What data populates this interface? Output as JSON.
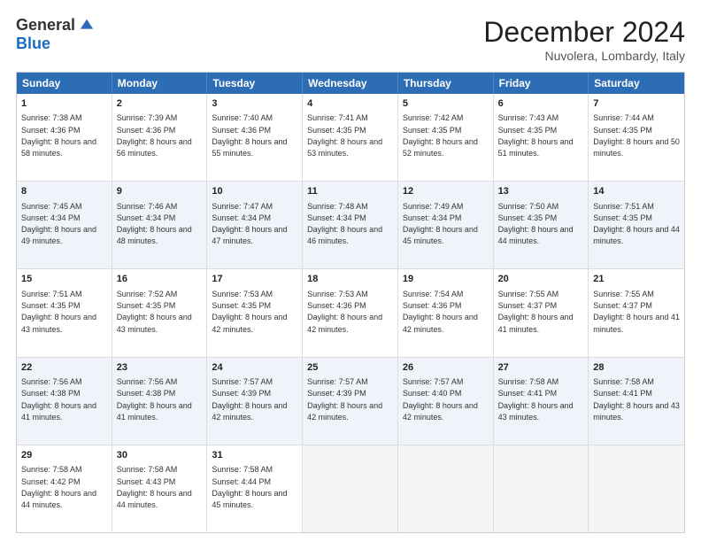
{
  "logo": {
    "general": "General",
    "blue": "Blue"
  },
  "title": "December 2024",
  "subtitle": "Nuvolera, Lombardy, Italy",
  "header_days": [
    "Sunday",
    "Monday",
    "Tuesday",
    "Wednesday",
    "Thursday",
    "Friday",
    "Saturday"
  ],
  "weeks": [
    [
      {
        "day": "1",
        "sunrise": "7:38 AM",
        "sunset": "4:36 PM",
        "daylight": "8 hours and 58 minutes."
      },
      {
        "day": "2",
        "sunrise": "7:39 AM",
        "sunset": "4:36 PM",
        "daylight": "8 hours and 56 minutes."
      },
      {
        "day": "3",
        "sunrise": "7:40 AM",
        "sunset": "4:36 PM",
        "daylight": "8 hours and 55 minutes."
      },
      {
        "day": "4",
        "sunrise": "7:41 AM",
        "sunset": "4:35 PM",
        "daylight": "8 hours and 53 minutes."
      },
      {
        "day": "5",
        "sunrise": "7:42 AM",
        "sunset": "4:35 PM",
        "daylight": "8 hours and 52 minutes."
      },
      {
        "day": "6",
        "sunrise": "7:43 AM",
        "sunset": "4:35 PM",
        "daylight": "8 hours and 51 minutes."
      },
      {
        "day": "7",
        "sunrise": "7:44 AM",
        "sunset": "4:35 PM",
        "daylight": "8 hours and 50 minutes."
      }
    ],
    [
      {
        "day": "8",
        "sunrise": "7:45 AM",
        "sunset": "4:34 PM",
        "daylight": "8 hours and 49 minutes."
      },
      {
        "day": "9",
        "sunrise": "7:46 AM",
        "sunset": "4:34 PM",
        "daylight": "8 hours and 48 minutes."
      },
      {
        "day": "10",
        "sunrise": "7:47 AM",
        "sunset": "4:34 PM",
        "daylight": "8 hours and 47 minutes."
      },
      {
        "day": "11",
        "sunrise": "7:48 AM",
        "sunset": "4:34 PM",
        "daylight": "8 hours and 46 minutes."
      },
      {
        "day": "12",
        "sunrise": "7:49 AM",
        "sunset": "4:34 PM",
        "daylight": "8 hours and 45 minutes."
      },
      {
        "day": "13",
        "sunrise": "7:50 AM",
        "sunset": "4:35 PM",
        "daylight": "8 hours and 44 minutes."
      },
      {
        "day": "14",
        "sunrise": "7:51 AM",
        "sunset": "4:35 PM",
        "daylight": "8 hours and 44 minutes."
      }
    ],
    [
      {
        "day": "15",
        "sunrise": "7:51 AM",
        "sunset": "4:35 PM",
        "daylight": "8 hours and 43 minutes."
      },
      {
        "day": "16",
        "sunrise": "7:52 AM",
        "sunset": "4:35 PM",
        "daylight": "8 hours and 43 minutes."
      },
      {
        "day": "17",
        "sunrise": "7:53 AM",
        "sunset": "4:35 PM",
        "daylight": "8 hours and 42 minutes."
      },
      {
        "day": "18",
        "sunrise": "7:53 AM",
        "sunset": "4:36 PM",
        "daylight": "8 hours and 42 minutes."
      },
      {
        "day": "19",
        "sunrise": "7:54 AM",
        "sunset": "4:36 PM",
        "daylight": "8 hours and 42 minutes."
      },
      {
        "day": "20",
        "sunrise": "7:55 AM",
        "sunset": "4:37 PM",
        "daylight": "8 hours and 41 minutes."
      },
      {
        "day": "21",
        "sunrise": "7:55 AM",
        "sunset": "4:37 PM",
        "daylight": "8 hours and 41 minutes."
      }
    ],
    [
      {
        "day": "22",
        "sunrise": "7:56 AM",
        "sunset": "4:38 PM",
        "daylight": "8 hours and 41 minutes."
      },
      {
        "day": "23",
        "sunrise": "7:56 AM",
        "sunset": "4:38 PM",
        "daylight": "8 hours and 41 minutes."
      },
      {
        "day": "24",
        "sunrise": "7:57 AM",
        "sunset": "4:39 PM",
        "daylight": "8 hours and 42 minutes."
      },
      {
        "day": "25",
        "sunrise": "7:57 AM",
        "sunset": "4:39 PM",
        "daylight": "8 hours and 42 minutes."
      },
      {
        "day": "26",
        "sunrise": "7:57 AM",
        "sunset": "4:40 PM",
        "daylight": "8 hours and 42 minutes."
      },
      {
        "day": "27",
        "sunrise": "7:58 AM",
        "sunset": "4:41 PM",
        "daylight": "8 hours and 43 minutes."
      },
      {
        "day": "28",
        "sunrise": "7:58 AM",
        "sunset": "4:41 PM",
        "daylight": "8 hours and 43 minutes."
      }
    ],
    [
      {
        "day": "29",
        "sunrise": "7:58 AM",
        "sunset": "4:42 PM",
        "daylight": "8 hours and 44 minutes."
      },
      {
        "day": "30",
        "sunrise": "7:58 AM",
        "sunset": "4:43 PM",
        "daylight": "8 hours and 44 minutes."
      },
      {
        "day": "31",
        "sunrise": "7:58 AM",
        "sunset": "4:44 PM",
        "daylight": "8 hours and 45 minutes."
      },
      null,
      null,
      null,
      null
    ]
  ]
}
